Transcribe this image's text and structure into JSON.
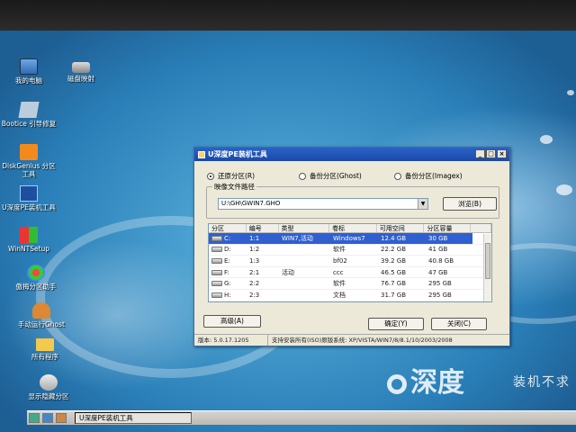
{
  "desktop": {
    "icons": [
      {
        "label": "我的电脑",
        "icon": "computer-icon"
      },
      {
        "label": "磁盘映射",
        "icon": "drive-icon"
      },
      {
        "label": "Bootice 引导修复",
        "icon": "boot-repair-icon"
      },
      {
        "label": "DiskGenius 分区工具",
        "icon": "diskgenius-icon"
      },
      {
        "label": "U深度PE装机工具",
        "icon": "pe-installer-icon"
      },
      {
        "label": "WinNTSetup",
        "icon": "windows-icon"
      },
      {
        "label": "傲梅分区助手",
        "icon": "partition-assistant-icon"
      },
      {
        "label": "手动运行Ghost",
        "icon": "ghost-icon"
      },
      {
        "label": "所有程序",
        "icon": "folder-icon"
      },
      {
        "label": "显示隐藏分区",
        "icon": "disk-icon"
      }
    ],
    "wallpaper_logo": "深度",
    "wallpaper_slogan": "装机不求"
  },
  "taskbar": {
    "task_label": "U深度PE装机工具"
  },
  "window": {
    "title": "U深度PE装机工具",
    "controls": {
      "minimize": "_",
      "maximize": "□",
      "close": "×"
    },
    "modes": [
      {
        "label": "还原分区(R)",
        "selected": true
      },
      {
        "label": "备份分区(Ghost)",
        "selected": false
      },
      {
        "label": "备份分区(Imagex)",
        "selected": false
      }
    ],
    "image_group_label": "映像文件路径",
    "image_path": "U:\\GH\\GWIN7.GHO",
    "browse_label": "浏览(B)",
    "table": {
      "columns": [
        "分区",
        "编号",
        "类型",
        "卷标",
        "可用空间",
        "分区容量"
      ],
      "rows": [
        {
          "part": "C:",
          "num": "1:1",
          "type": "WIN7,活动",
          "label": "Windows7",
          "free": "12.4 GB",
          "size": "30 GB",
          "selected": true
        },
        {
          "part": "D:",
          "num": "1:2",
          "type": "",
          "label": "软件",
          "free": "22.2 GB",
          "size": "41 GB",
          "selected": false
        },
        {
          "part": "E:",
          "num": "1:3",
          "type": "",
          "label": "bf02",
          "free": "39.2 GB",
          "size": "40.8 GB",
          "selected": false
        },
        {
          "part": "F:",
          "num": "2:1",
          "type": "活动",
          "label": "ccc",
          "free": "46.5 GB",
          "size": "47 GB",
          "selected": false
        },
        {
          "part": "G:",
          "num": "2:2",
          "type": "",
          "label": "软件",
          "free": "76.7 GB",
          "size": "295 GB",
          "selected": false
        },
        {
          "part": "H:",
          "num": "2:3",
          "type": "",
          "label": "文档",
          "free": "31.7 GB",
          "size": "295 GB",
          "selected": false
        }
      ]
    },
    "advanced_label": "高级(A)",
    "ok_label": "确定(Y)",
    "close_label": "关闭(C)",
    "status_version": "版本: 5.0.17.1205",
    "status_info": "支持安装所有(ISO)原版系统: XP/VISTA/WIN7/8/8.1/10/2003/2008"
  }
}
